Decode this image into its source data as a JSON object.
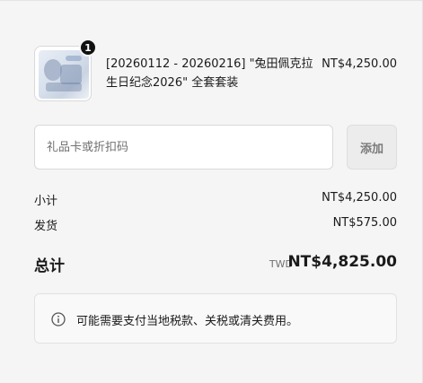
{
  "product": {
    "quantity_badge": "1",
    "title": "[20260112 - 20260216] \"兔田佩克拉生日纪念2026\" 全套套装",
    "price": "NT$4,250.00",
    "thumbnail_icon": "product-thumbnail"
  },
  "discount": {
    "placeholder": "礼品卡或折扣码",
    "apply_label": "添加"
  },
  "summary": {
    "subtotal_label": "小计",
    "subtotal_value": "NT$4,250.00",
    "shipping_label": "发货",
    "shipping_value": "NT$575.00",
    "total_label": "总计",
    "total_currency": "TWD",
    "total_value": "NT$4,825.00"
  },
  "notice": {
    "icon": "info-icon",
    "text": "可能需要支付当地税款、关税或清关费用。"
  },
  "colors": {
    "background": "#f5f5f5",
    "badge": "#111111",
    "button_bg": "#ececec"
  }
}
